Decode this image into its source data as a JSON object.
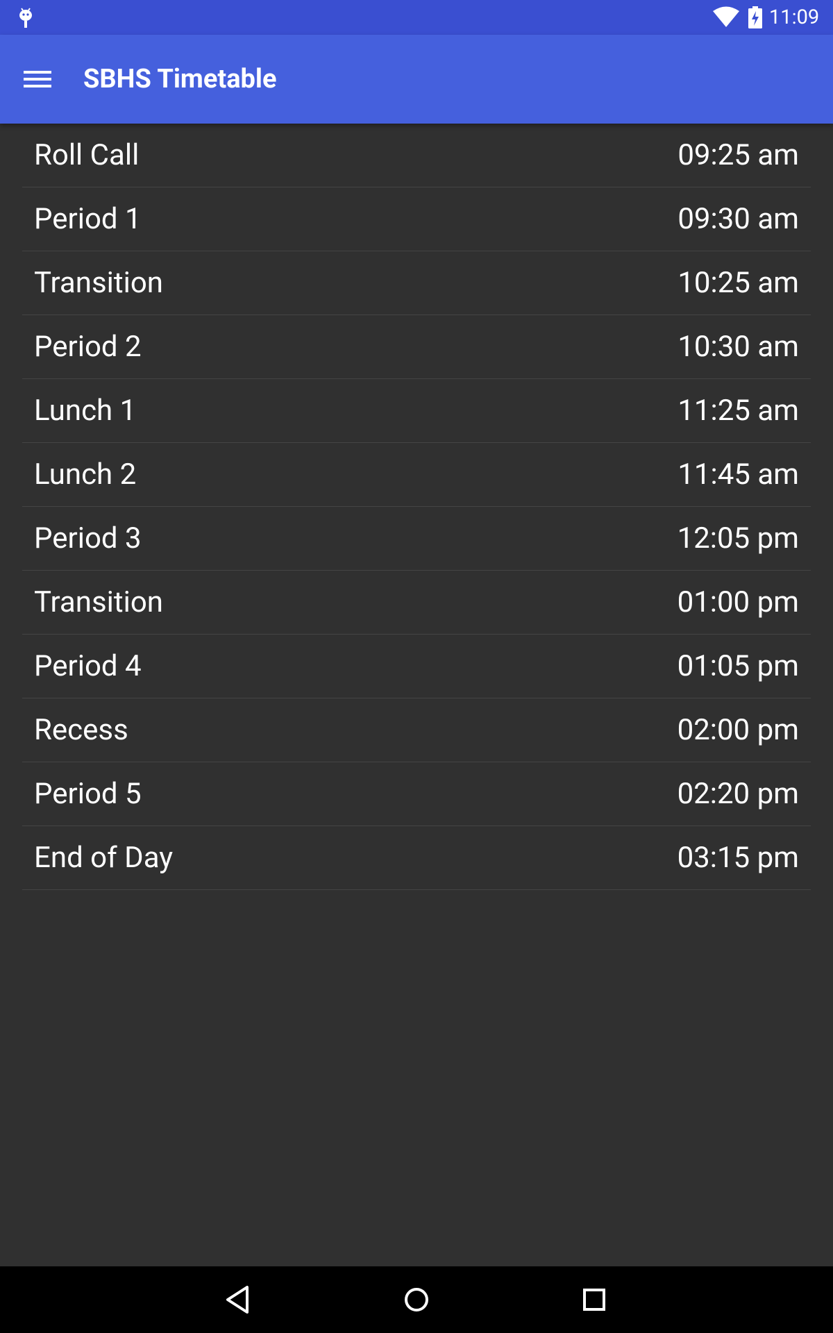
{
  "status_bar": {
    "time": "11:09",
    "notification_icon": "android-debug-icon",
    "wifi_icon": "wifi-icon",
    "battery_icon": "battery-charging-icon",
    "background_color": "#3a4fd1"
  },
  "app_bar": {
    "title": "SBHS Timetable",
    "menu_icon": "hamburger-menu-icon",
    "background_color": "#4560dd"
  },
  "timetable": {
    "rows": [
      {
        "label": "Roll Call",
        "time": "09:25 am"
      },
      {
        "label": "Period 1",
        "time": "09:30 am"
      },
      {
        "label": "Transition",
        "time": "10:25 am"
      },
      {
        "label": "Period 2",
        "time": "10:30 am"
      },
      {
        "label": "Lunch 1",
        "time": "11:25 am"
      },
      {
        "label": "Lunch 2",
        "time": "11:45 am"
      },
      {
        "label": "Period 3",
        "time": "12:05 pm"
      },
      {
        "label": "Transition",
        "time": "01:00 pm"
      },
      {
        "label": "Period 4",
        "time": "01:05 pm"
      },
      {
        "label": "Recess",
        "time": "02:00 pm"
      },
      {
        "label": "Period 5",
        "time": "02:20 pm"
      },
      {
        "label": "End of Day",
        "time": "03:15 pm"
      }
    ]
  },
  "nav_bar": {
    "back_icon": "back-triangle-icon",
    "home_icon": "home-circle-icon",
    "recents_icon": "recents-square-icon"
  },
  "colors": {
    "page_background": "#303030",
    "divider": "#444444",
    "text": "#ffffff"
  }
}
